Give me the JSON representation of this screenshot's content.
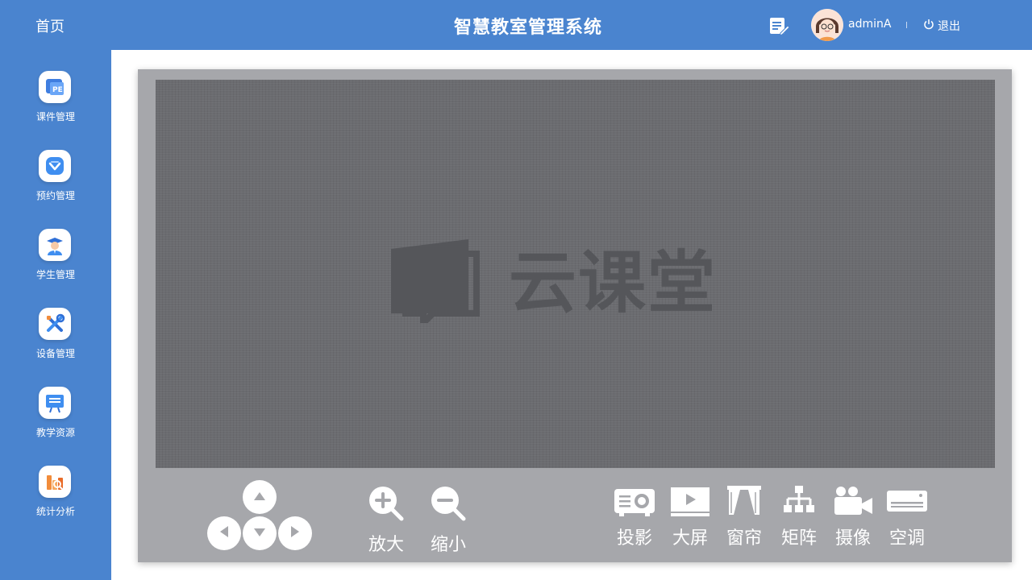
{
  "header": {
    "home_label": "首页",
    "title": "智慧教室管理系统",
    "username": "adminA",
    "logout_label": "退出",
    "icons": {
      "note": "edit-note-icon",
      "logout": "power-icon"
    }
  },
  "sidebar": {
    "items": [
      {
        "label": "课件管理",
        "icon": "courseware-icon"
      },
      {
        "label": "预约管理",
        "icon": "reservation-icon"
      },
      {
        "label": "学生管理",
        "icon": "student-icon"
      },
      {
        "label": "设备管理",
        "icon": "tools-icon"
      },
      {
        "label": "教学资源",
        "icon": "resource-board-icon"
      },
      {
        "label": "统计分析",
        "icon": "statistics-icon"
      }
    ]
  },
  "screen": {
    "brand_name": "云课堂"
  },
  "controls": {
    "zoom_in_label": "放大",
    "zoom_out_label": "缩小",
    "devices": [
      {
        "label": "投影",
        "icon": "projector-icon"
      },
      {
        "label": "大屏",
        "icon": "big-screen-icon"
      },
      {
        "label": "窗帘",
        "icon": "curtain-icon"
      },
      {
        "label": "矩阵",
        "icon": "matrix-icon"
      },
      {
        "label": "摄像",
        "icon": "camera-icon"
      },
      {
        "label": "空调",
        "icon": "air-conditioner-icon"
      }
    ]
  },
  "colors": {
    "brand_blue": "#4a84cf",
    "panel_gray": "#a6a7ab",
    "screen_gray": "#6b6c70"
  }
}
